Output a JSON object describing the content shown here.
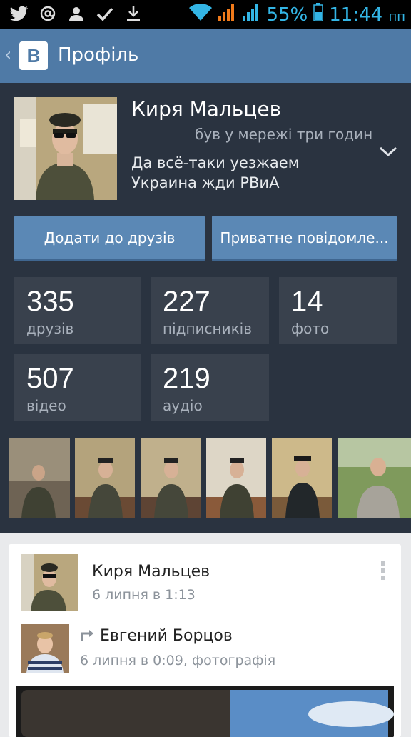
{
  "status_bar": {
    "battery": "55%",
    "time": "11:44",
    "ampm": "пп",
    "left_icons": [
      "twitter-icon",
      "at-icon",
      "person-icon",
      "check-icon",
      "download-icon"
    ],
    "right_icons": [
      "wifi-icon",
      "signal-orange-icon",
      "signal-blue-icon",
      "battery-icon"
    ]
  },
  "action_bar": {
    "logo": "В",
    "title": "Профіль"
  },
  "profile": {
    "name": "Киря Мальцев",
    "last_seen": "був у мережі три годин",
    "status": "Да всё-таки уезжаем\nУкраина жди РВиА",
    "add_friend_label": "Додати до друзів",
    "message_label": "Приватне повідомле..."
  },
  "stats": [
    {
      "value": "335",
      "label": "друзів"
    },
    {
      "value": "227",
      "label": "підписників"
    },
    {
      "value": "14",
      "label": "фото"
    },
    {
      "value": "507",
      "label": "відео"
    },
    {
      "value": "219",
      "label": "аудіо"
    }
  ],
  "post": {
    "author": "Киря Мальцев",
    "time": "6 липня в 1:13",
    "repost_author": "Евгений Борцов",
    "repost_time": "6 липня в 0:09, фотографія"
  },
  "colors": {
    "action_bar": "#4f7aa6",
    "profile_bg": "#2a3340",
    "stat_tile": "#39414d",
    "button": "#5b88b5",
    "status_blue": "#33b5e5"
  }
}
